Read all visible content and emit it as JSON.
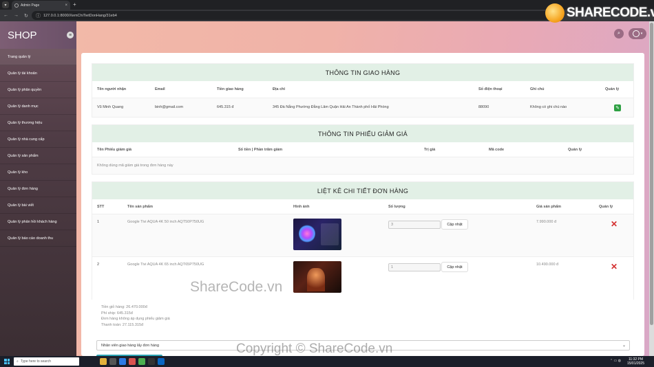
{
  "browser": {
    "tab_title": "Admin Page",
    "url": "127.0.0.1:8000/XemChiTietDonHang/31eb4"
  },
  "sidebar": {
    "brand": "SHOP",
    "items": [
      {
        "label": "Trang quản lý"
      },
      {
        "label": "Quản lý tài khoản"
      },
      {
        "label": "Quản lý phân quyền"
      },
      {
        "label": "Quản lý danh mục"
      },
      {
        "label": "Quản lý thương hiệu"
      },
      {
        "label": "Quản lý nhà cung cấp"
      },
      {
        "label": "Quản lý sản phẩm"
      },
      {
        "label": "Quản lý kho"
      },
      {
        "label": "Quản lý đơn hàng"
      },
      {
        "label": "Quản lý bài viết"
      },
      {
        "label": "Quản lý phản hồi khách hàng"
      },
      {
        "label": "Quản lý báo cáo doanh thu"
      }
    ]
  },
  "shipping": {
    "title": "THÔNG TIN GIAO HÀNG",
    "headers": {
      "name": "Tên người nhận",
      "email": "Email",
      "fee": "Tiền giao hàng",
      "address": "Địa chỉ",
      "phone": "Số điện thoại",
      "note": "Ghi chú",
      "manage": "Quản lý"
    },
    "row": {
      "name": "Vũ Minh Quang",
      "email": "binh@gmail.com",
      "fee": "645.315 đ",
      "address": "345 Đà Nẵng Phường Đằng Lâm Quận Hải An Thành phố Hải Phòng",
      "phone": "88090",
      "note": "Không có ghi chú nào"
    }
  },
  "voucher": {
    "title": "THÔNG TIN PHIẾU GIẢM GIÁ",
    "headers": {
      "name": "Tên Phiếu giảm giá",
      "amount": "Số tiền | Phần trăm giảm",
      "value": "Trị giá",
      "code": "Mã code",
      "manage": "Quản lý"
    },
    "empty": "Không dùng mã giảm giá trong đơn hàng này"
  },
  "details": {
    "title": "LIỆT KÊ CHI TIẾT ĐƠN HÀNG",
    "headers": {
      "stt": "STT",
      "product": "Tên sản phẩm",
      "image": "Hình ảnh",
      "qty": "Số lượng",
      "price": "Giá sản phẩm",
      "manage": "Quản lý"
    },
    "update_label": "Cập nhật",
    "rows": [
      {
        "stt": "1",
        "product": "Google Tivi AQUA 4K 50 inch AQT50P750UG",
        "qty": "3",
        "price": "7.990.000 đ"
      },
      {
        "stt": "2",
        "product": "Google Tivi AQUA 4K 65 inch AQT65P750UG",
        "qty": "1",
        "price": "10.490.000 đ"
      }
    ],
    "totals": [
      "Tiền giỏ hàng: 26.470.000đ",
      "Phí ship: 645.315đ",
      "Đơn hàng không áp dụng phiếu giảm giá",
      "Thanh toán: 27.115.315đ"
    ]
  },
  "status_select": {
    "value": "Nhân viên giao hàng lấy đơn hàng"
  },
  "taskbar": {
    "search_placeholder": "Type here to search",
    "time": "11:32 PM",
    "date": "15/01/2025"
  },
  "watermarks": {
    "logo": "SHARECODE.vn",
    "middle": "ShareCode.vn",
    "bottom": "Copyright © ShareCode.vn"
  }
}
